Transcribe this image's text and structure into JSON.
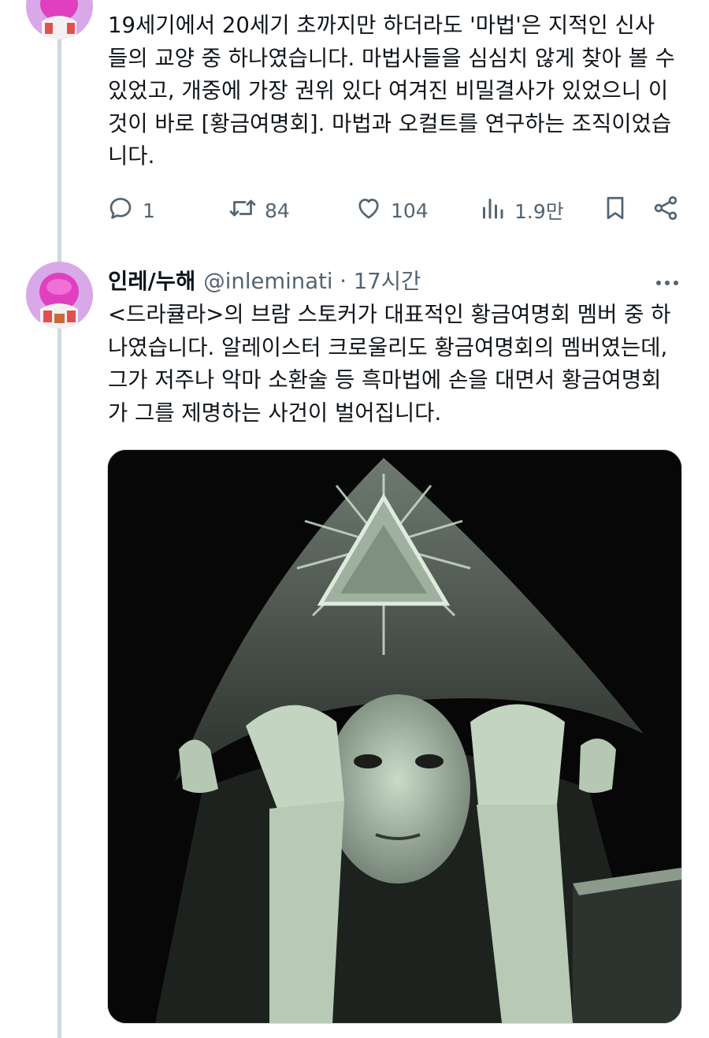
{
  "colors": {
    "text": "#0f1419",
    "secondary": "#536471",
    "thread_line": "#cfd9de",
    "avatar_bg": "#d8a8e8",
    "photo_tint": "#c9dcc8"
  },
  "tweet1": {
    "text": "19세기에서 20세기 초까지만 하더라도 '마법'은 지적인 신사\n들의 교양 중 하나였습니다. 마법사들을 심심치 않게 찾아 볼 수\n있었고, 개중에 가장 권위 있다 여겨진 비밀결사가 있었으니 이\n것이 바로 [황금여명회]. 마법과 오컬트를 연구하는 조직이었습\n니다.",
    "actions": {
      "reply_icon": "reply-icon",
      "reply_count": "1",
      "retweet_icon": "retweet-icon",
      "retweet_count": "84",
      "like_icon": "heart-icon",
      "like_count": "104",
      "views_icon": "views-icon",
      "views_count": "1.9만",
      "bookmark_icon": "bookmark-icon",
      "share_icon": "share-icon"
    }
  },
  "tweet2": {
    "display_name": "인레/누해",
    "handle_time": "@inleminati · 17시간",
    "more_icon": "more-icon",
    "text": "<드라큘라>의 브람 스토커가 대표적인 황금여명회 멤버 중 하\n나였습니다. 알레이스터 크로울리도 황금여명회의 멤버였는데,\n그가 저주나 악마 소환술 등 흑마법에 손을 대면서 황금여명회\n가 그를 제명하는 사건이 벌어집니다."
  }
}
